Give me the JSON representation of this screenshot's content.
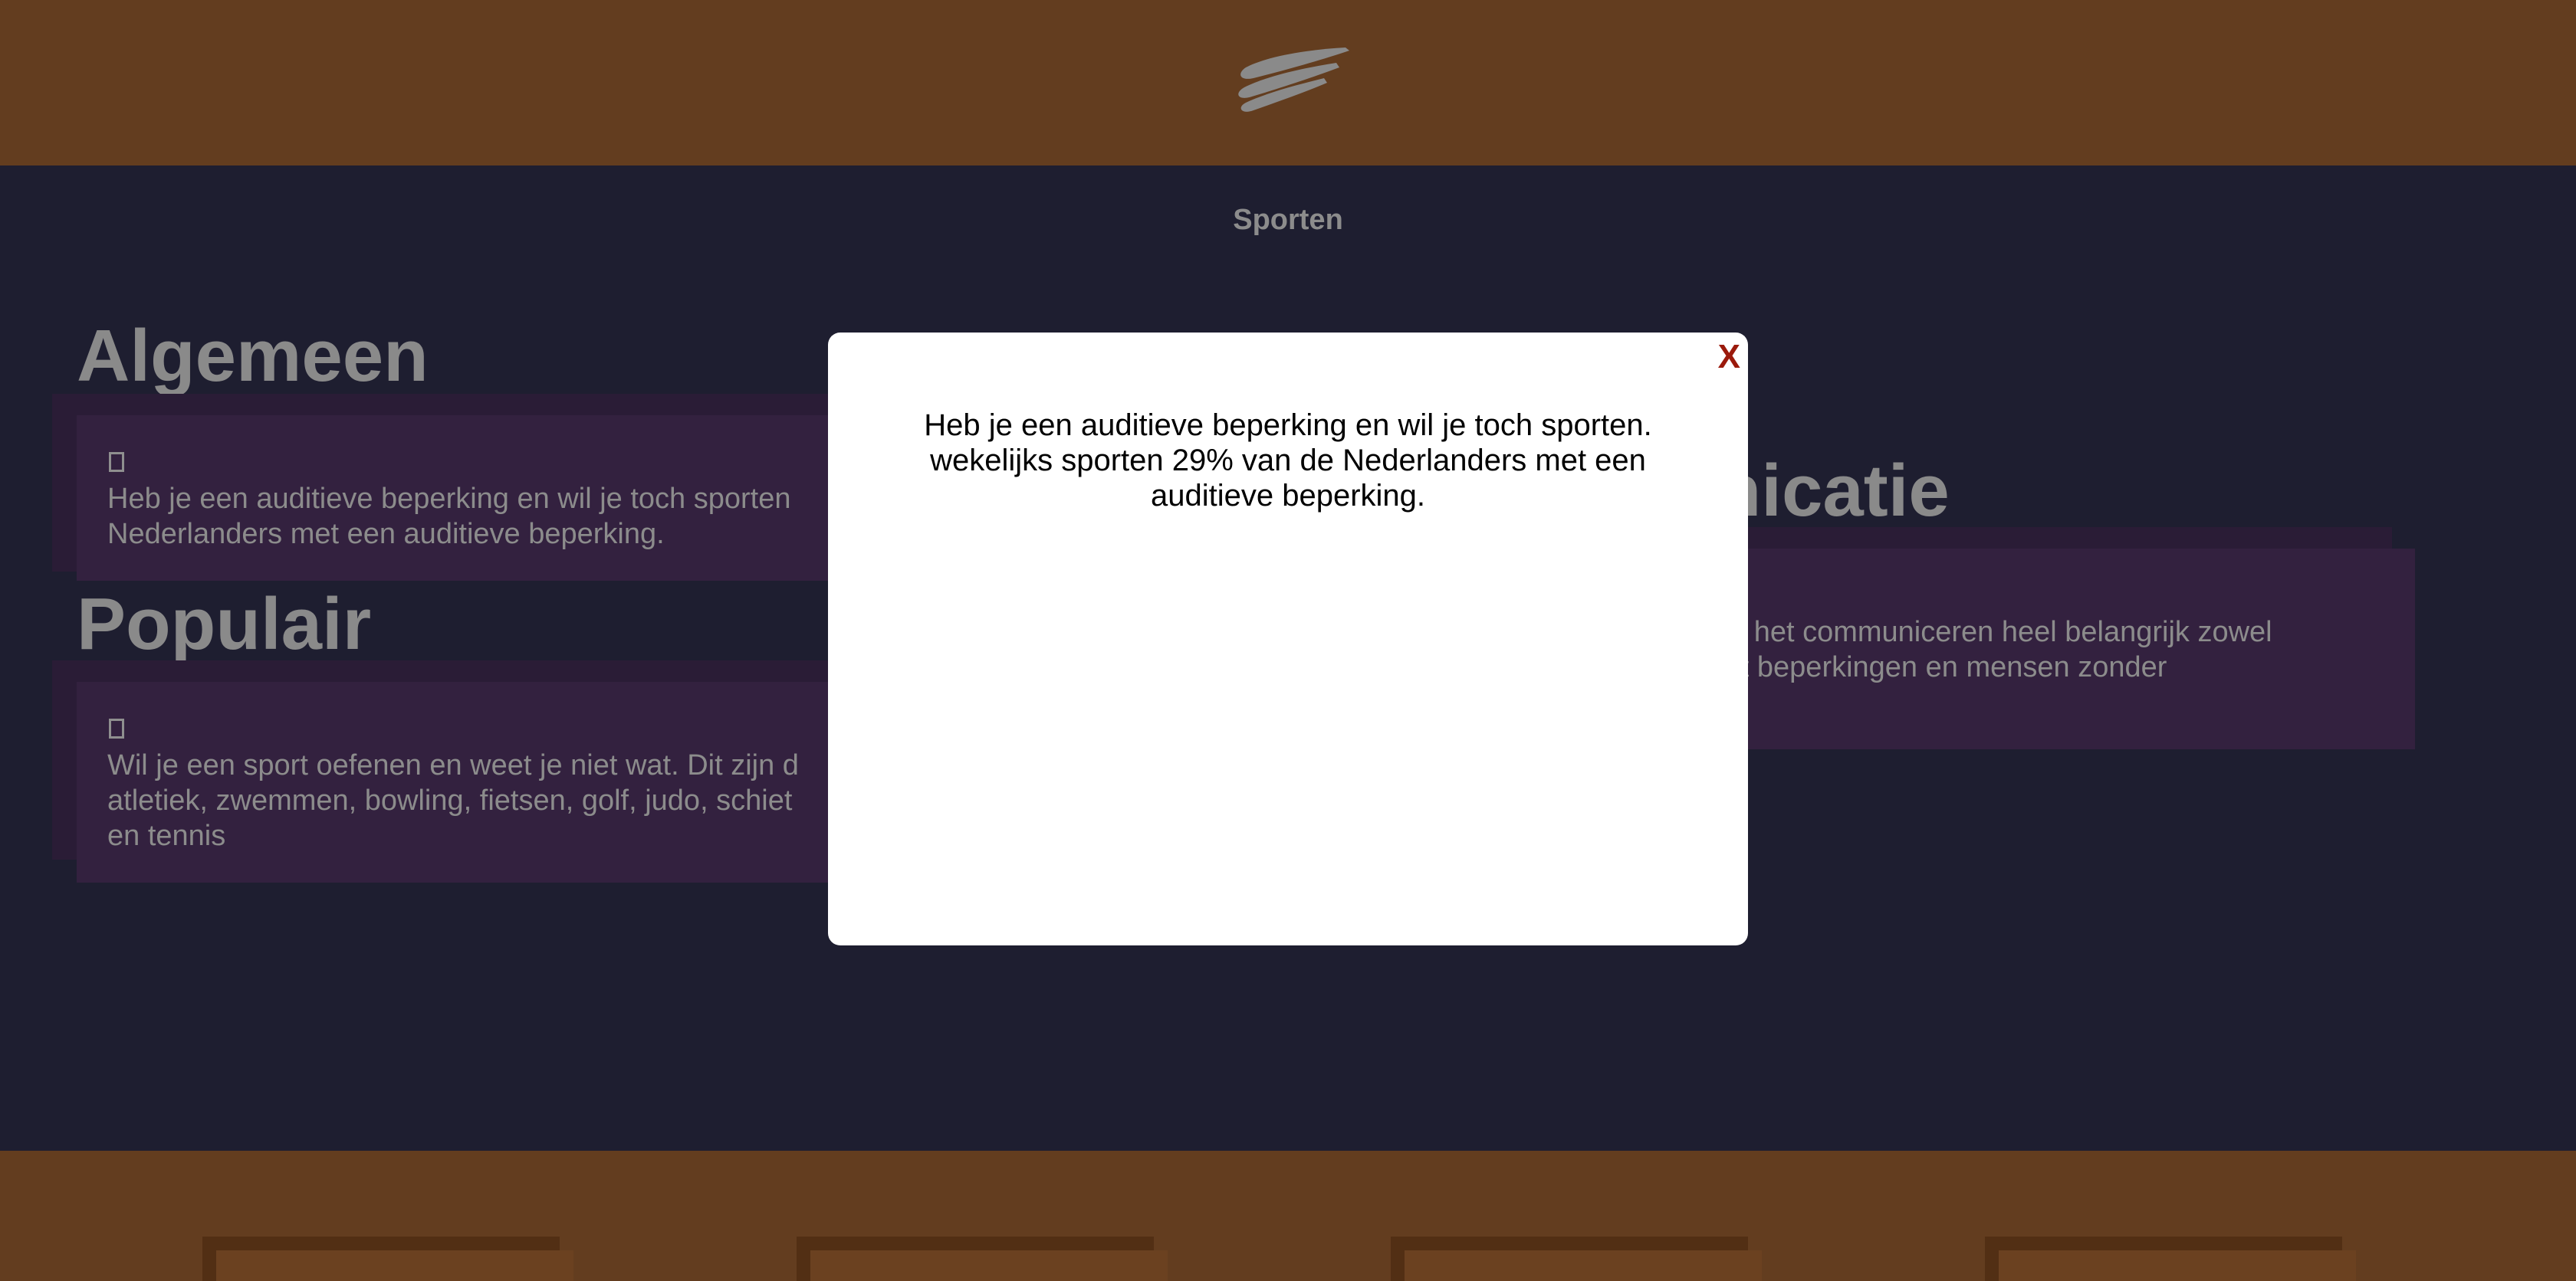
{
  "header": {
    "logo": "wing-logo"
  },
  "nav": {
    "link": "Sporten"
  },
  "sections": {
    "algemeen": {
      "title": "Algemeen",
      "icon": "square-icon",
      "line1": "Heb je een auditieve beperking en wil je toch sporten",
      "line2": "Nederlanders met een auditieve beperking."
    },
    "populair": {
      "title": "Populair",
      "icon": "square-icon",
      "line1": "Wil je een sport oefenen en weet je niet wat. Dit zijn d",
      "line2": "atletiek, zwemmen, bowling, fietsen, golf, judo, schiet",
      "line3": "en tennis"
    },
    "communicatie": {
      "title": "unicatie",
      "line1": "n is het communiceren heel belangrijk zowel",
      "line2": "met beperkingen en mensen zonder"
    }
  },
  "modal": {
    "close_label": "X",
    "line1": "Heb je een auditieve beperking en wil je toch sporten.",
    "line2": "wekelijks sporten 29% van de Nederlanders met een",
    "line3": "auditieve beperking."
  },
  "colors": {
    "header_brown": "#633d1f",
    "main_navy": "#1e1e30",
    "card_purple": "#33213f",
    "close_red": "#9b1a0c"
  }
}
